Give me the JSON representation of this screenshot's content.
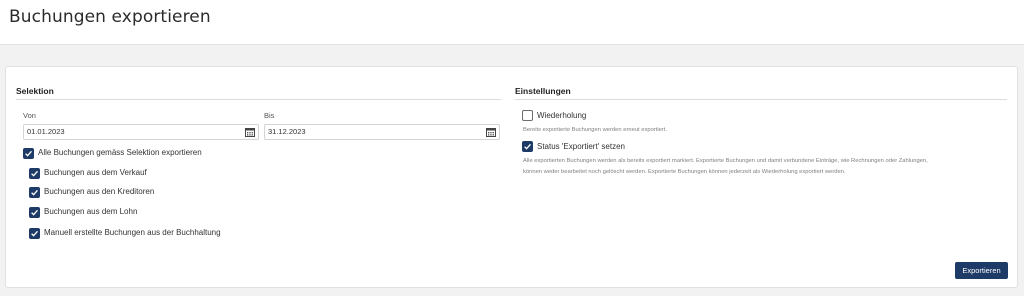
{
  "header": {
    "title": "Buchungen exportieren"
  },
  "selektion": {
    "title": "Selektion",
    "von": {
      "label": "Von",
      "value": "01.01.2023"
    },
    "bis": {
      "label": "Bis",
      "value": "31.12.2023"
    },
    "all_checkbox": {
      "label": "Alle Buchungen gemäss Selektion exportieren",
      "checked": true
    },
    "items": [
      {
        "label": "Buchungen aus dem Verkauf",
        "checked": true
      },
      {
        "label": "Buchungen aus den Kreditoren",
        "checked": true
      },
      {
        "label": "Buchungen aus dem Lohn",
        "checked": true
      },
      {
        "label": "Manuell erstellte Buchungen aus der Buchhaltung",
        "checked": true
      }
    ]
  },
  "einstellungen": {
    "title": "Einstellungen",
    "wiederholung": {
      "label": "Wiederholung",
      "checked": false,
      "help": "Bereits exportierte Buchungen werden erneut exportiert."
    },
    "status": {
      "label": "Status 'Exportiert' setzen",
      "checked": true,
      "help_line1": "Alle exportierten Buchungen werden als bereits exportiert markiert. Exportierte Buchungen und damit verbundene Einträge, wie Rechnungen oder Zahlungen,",
      "help_line2": "können weder bearbeitet noch gelöscht werden. Exportierte Buchungen können jederzeit als Wiederholung exportiert werden."
    }
  },
  "actions": {
    "export_label": "Exportieren"
  },
  "colors": {
    "accent": "#1e3a66",
    "background": "#f2f2f3"
  },
  "icons": {
    "date": "calendar-icon",
    "check": "checkmark-icon"
  }
}
